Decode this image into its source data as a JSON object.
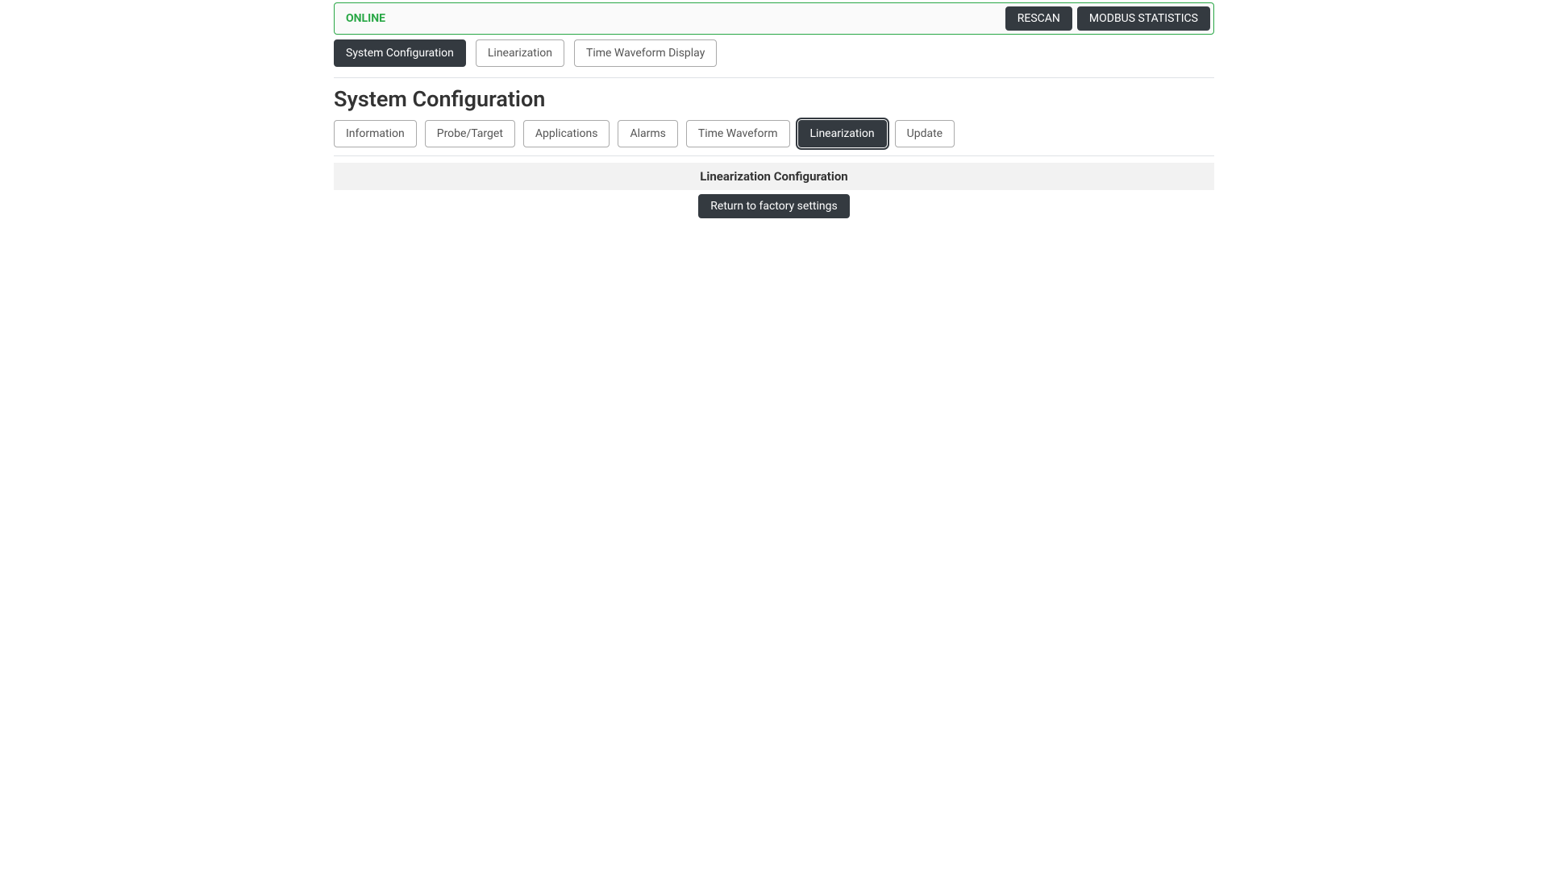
{
  "status": {
    "text": "ONLINE",
    "rescan_label": "RESCAN",
    "modbus_label": "MODBUS STATISTICS"
  },
  "main_tabs": [
    {
      "label": "System Configuration",
      "active": true
    },
    {
      "label": "Linearization",
      "active": false
    },
    {
      "label": "Time Waveform Display",
      "active": false
    }
  ],
  "page_title": "System Configuration",
  "sub_tabs": [
    {
      "label": "Information",
      "active": false
    },
    {
      "label": "Probe/Target",
      "active": false
    },
    {
      "label": "Applications",
      "active": false
    },
    {
      "label": "Alarms",
      "active": false
    },
    {
      "label": "Time Waveform",
      "active": false
    },
    {
      "label": "Linearization",
      "active": true
    },
    {
      "label": "Update",
      "active": false
    }
  ],
  "section": {
    "header": "Linearization Configuration",
    "factory_button": "Return to factory settings"
  }
}
